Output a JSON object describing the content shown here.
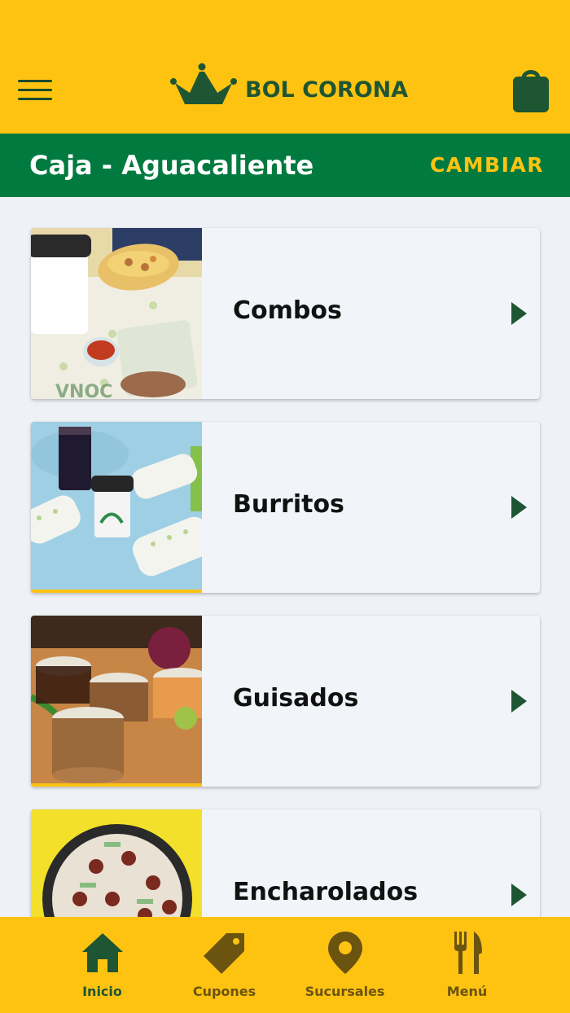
{
  "header": {
    "brand": "BOL CORONA",
    "icons": {
      "menu": "hamburger-menu-icon",
      "cart": "shopping-bag-icon",
      "logo": "crown-logo-icon"
    }
  },
  "branch": {
    "name": "Caja - Aguacaliente",
    "change_label": "CAMBIAR"
  },
  "categories": [
    {
      "label": "Combos"
    },
    {
      "label": "Burritos"
    },
    {
      "label": "Guisados"
    },
    {
      "label": "Encharolados"
    }
  ],
  "tabs": [
    {
      "label": "Inicio",
      "icon": "home-icon",
      "active": true
    },
    {
      "label": "Cupones",
      "icon": "tag-icon",
      "active": false
    },
    {
      "label": "Sucursales",
      "icon": "location-pin-icon",
      "active": false
    },
    {
      "label": "Menú",
      "icon": "fork-knife-icon",
      "active": false
    }
  ],
  "colors": {
    "brand_yellow": "#fec311",
    "brand_green": "#007a3f",
    "dark_green": "#1e5633",
    "background": "#eef2f6"
  }
}
